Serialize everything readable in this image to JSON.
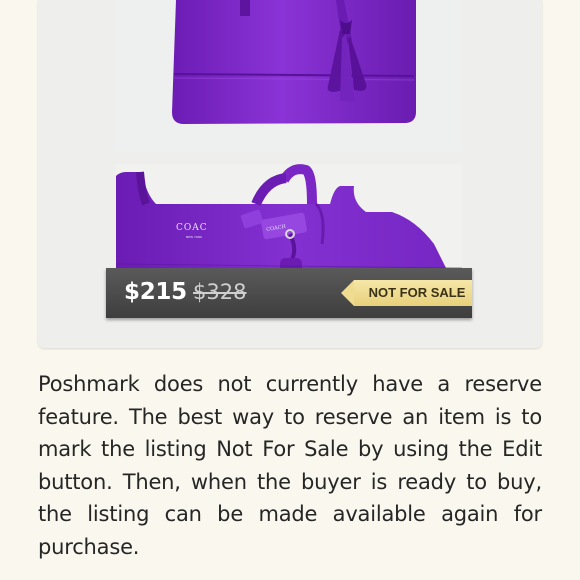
{
  "listing": {
    "price": "$215",
    "original_price": "$328",
    "status_tag": "NOT FOR SALE",
    "photos": [
      "purple-leather-tote-bottom",
      "purple-coach-bag-with-tassel"
    ],
    "brand_stamp": "COAC"
  },
  "comment": {
    "text": "Poshmark does not currently have a reserve feature. The best way to reserve an item is to mark the listing Not For Sale by using the Edit button. Then, when the buyer is ready to buy, the listing can be made available again for purchase."
  },
  "colors": {
    "page_background": "#faf7ee",
    "card_background": "#eeeeec",
    "bag_purple": "#7a22c4",
    "price_bar": "#464646",
    "tag_gold": "#eedb8d"
  }
}
